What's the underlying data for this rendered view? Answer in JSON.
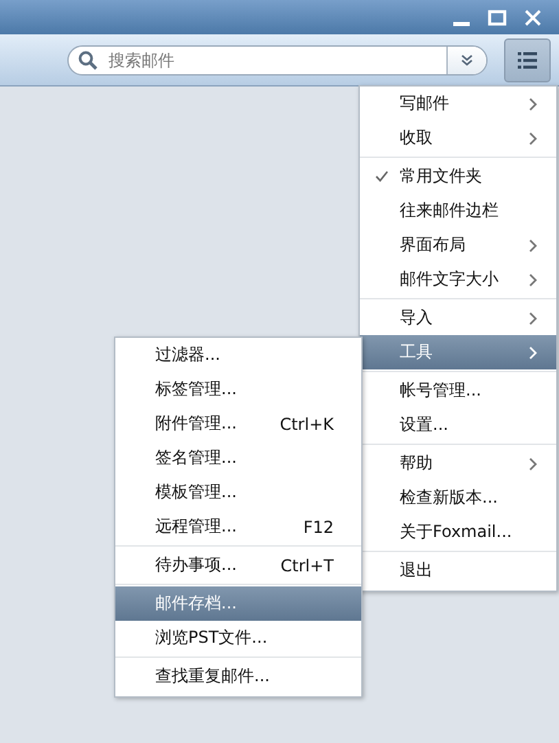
{
  "search": {
    "placeholder": "搜索邮件"
  },
  "main_menu": {
    "sections": [
      [
        {
          "label": "写邮件",
          "submenu": true,
          "checked": false,
          "selected": false
        },
        {
          "label": "收取",
          "submenu": true,
          "checked": false,
          "selected": false
        }
      ],
      [
        {
          "label": "常用文件夹",
          "submenu": false,
          "checked": true,
          "selected": false
        },
        {
          "label": "往来邮件边栏",
          "submenu": false,
          "checked": false,
          "selected": false
        },
        {
          "label": "界面布局",
          "submenu": true,
          "checked": false,
          "selected": false
        },
        {
          "label": "邮件文字大小",
          "submenu": true,
          "checked": false,
          "selected": false
        }
      ],
      [
        {
          "label": "导入",
          "submenu": true,
          "checked": false,
          "selected": false
        },
        {
          "label": "工具",
          "submenu": true,
          "checked": false,
          "selected": true
        }
      ],
      [
        {
          "label": "帐号管理...",
          "submenu": false,
          "checked": false,
          "selected": false
        },
        {
          "label": "设置...",
          "submenu": false,
          "checked": false,
          "selected": false
        }
      ],
      [
        {
          "label": "帮助",
          "submenu": true,
          "checked": false,
          "selected": false
        },
        {
          "label": "检查新版本...",
          "submenu": false,
          "checked": false,
          "selected": false
        },
        {
          "label": "关于Foxmail...",
          "submenu": false,
          "checked": false,
          "selected": false
        }
      ],
      [
        {
          "label": "退出",
          "submenu": false,
          "checked": false,
          "selected": false
        }
      ]
    ]
  },
  "tools_menu": {
    "sections": [
      [
        {
          "label": "过滤器...",
          "selected": false
        },
        {
          "label": "标签管理...",
          "selected": false
        },
        {
          "label": "附件管理...",
          "shortcut": "Ctrl+K",
          "selected": false
        },
        {
          "label": "签名管理...",
          "selected": false
        },
        {
          "label": "模板管理...",
          "selected": false
        },
        {
          "label": "远程管理...",
          "shortcut": "F12",
          "selected": false
        }
      ],
      [
        {
          "label": "待办事项...",
          "shortcut": "Ctrl+T",
          "selected": false
        }
      ],
      [
        {
          "label": "邮件存档...",
          "selected": true
        },
        {
          "label": "浏览PST文件...",
          "selected": false
        }
      ],
      [
        {
          "label": "查找重复邮件...",
          "selected": false
        }
      ]
    ]
  }
}
